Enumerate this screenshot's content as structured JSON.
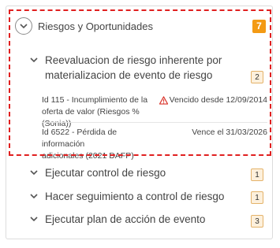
{
  "card": {
    "title": "Riesgos y Oportunidades",
    "count": "7"
  },
  "sections": [
    {
      "title_line1": "Reevaluacion de riesgo inherente por",
      "title_line2": "materializacion de evento de riesgo",
      "count": "2",
      "expanded": true,
      "tasks": [
        {
          "name_line1": "Id 115 - Incumplimiento de la",
          "name_line2": "oferta de valor (Riesgos % (Sonia))",
          "due": "Vencido desde 12/09/2014",
          "overdue": true
        },
        {
          "name_line1": "Id 6522 - Pérdida de información",
          "name_line2": "adicionales (2021 DAFP)",
          "due": "Vence el 31/03/2026",
          "overdue": false
        }
      ]
    },
    {
      "title": "Ejecutar control de riesgo",
      "count": "1",
      "expanded": false
    },
    {
      "title": "Hacer seguimiento a control de riesgo",
      "count": "1",
      "expanded": false
    },
    {
      "title": "Ejecutar plan de acción de evento",
      "count": "3",
      "expanded": false
    }
  ],
  "colors": {
    "accent_badge": "#f39a14",
    "small_badge_bg": "#fdf0dc",
    "small_badge_border": "#e4b36a",
    "warning": "#d9342b",
    "highlight_border": "#e02020"
  }
}
